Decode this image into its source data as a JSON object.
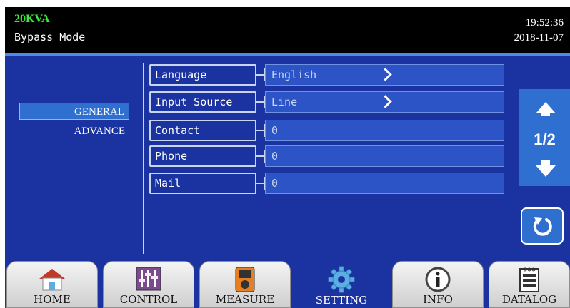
{
  "header": {
    "model": "20KVA",
    "mode": "Bypass Mode",
    "time": "19:52:36",
    "date": "2018-11-07"
  },
  "side_menu": {
    "items": [
      "GENERAL",
      "ADVANCE"
    ],
    "active": "GENERAL"
  },
  "settings": [
    {
      "label": "Language",
      "value": "English",
      "has_arrow": true
    },
    {
      "label": "Input Source",
      "value": "Line",
      "has_arrow": true
    },
    {
      "label": "Contact",
      "value": "0",
      "has_arrow": false
    },
    {
      "label": "Phone",
      "value": "0",
      "has_arrow": false
    },
    {
      "label": "Mail",
      "value": "0",
      "has_arrow": false
    }
  ],
  "pagination": {
    "page": "1/2"
  },
  "bottom_nav": {
    "tabs": [
      "HOME",
      "CONTROL",
      "MEASURE",
      "SETTING",
      "INFO",
      "DATALOG"
    ],
    "active": "SETTING"
  },
  "icons": {
    "page_up": "arrow-up-icon",
    "page_down": "arrow-down-icon",
    "refresh": "refresh-icon",
    "setting_arrow": "chevron-right-icon"
  },
  "colors": {
    "background": "#1a33a0",
    "header": "#000000",
    "model_text": "#3ee63e",
    "active_item": "#2f6fcf",
    "value_field": "#2c54c6"
  }
}
